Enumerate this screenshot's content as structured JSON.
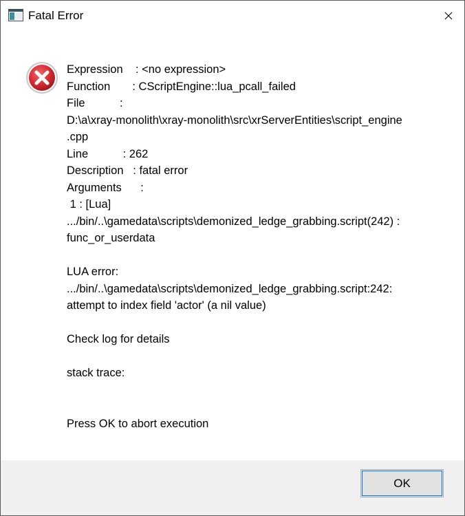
{
  "window": {
    "title": "Fatal Error",
    "icon": "app-window-icon",
    "close_icon": "close-icon"
  },
  "dialog": {
    "icon": "error-icon",
    "message_lines": [
      "Expression    : <no expression>",
      "Function       : CScriptEngine::lua_pcall_failed",
      "File           :",
      "D:\\a\\xray-monolith\\xray-monolith\\src\\xrServerEntities\\script_engine",
      ".cpp",
      "Line           : 262",
      "Description   : fatal error",
      "Arguments      :",
      " 1 : [Lua]",
      ".../bin/..\\gamedata\\scripts\\demonized_ledge_grabbing.script(242) :",
      "func_or_userdata",
      "",
      "LUA error:",
      ".../bin/..\\gamedata\\scripts\\demonized_ledge_grabbing.script:242:",
      "attempt to index field 'actor' (a nil value)",
      "",
      "Check log for details",
      "",
      "stack trace:",
      "",
      "",
      "Press OK to abort execution"
    ]
  },
  "buttons": {
    "ok_label": "OK"
  },
  "colors": {
    "error_red": "#c9252c",
    "footer_bg": "#f0f0f0",
    "button_bg": "#e1e1e1",
    "focus_blue": "#0078d7"
  }
}
